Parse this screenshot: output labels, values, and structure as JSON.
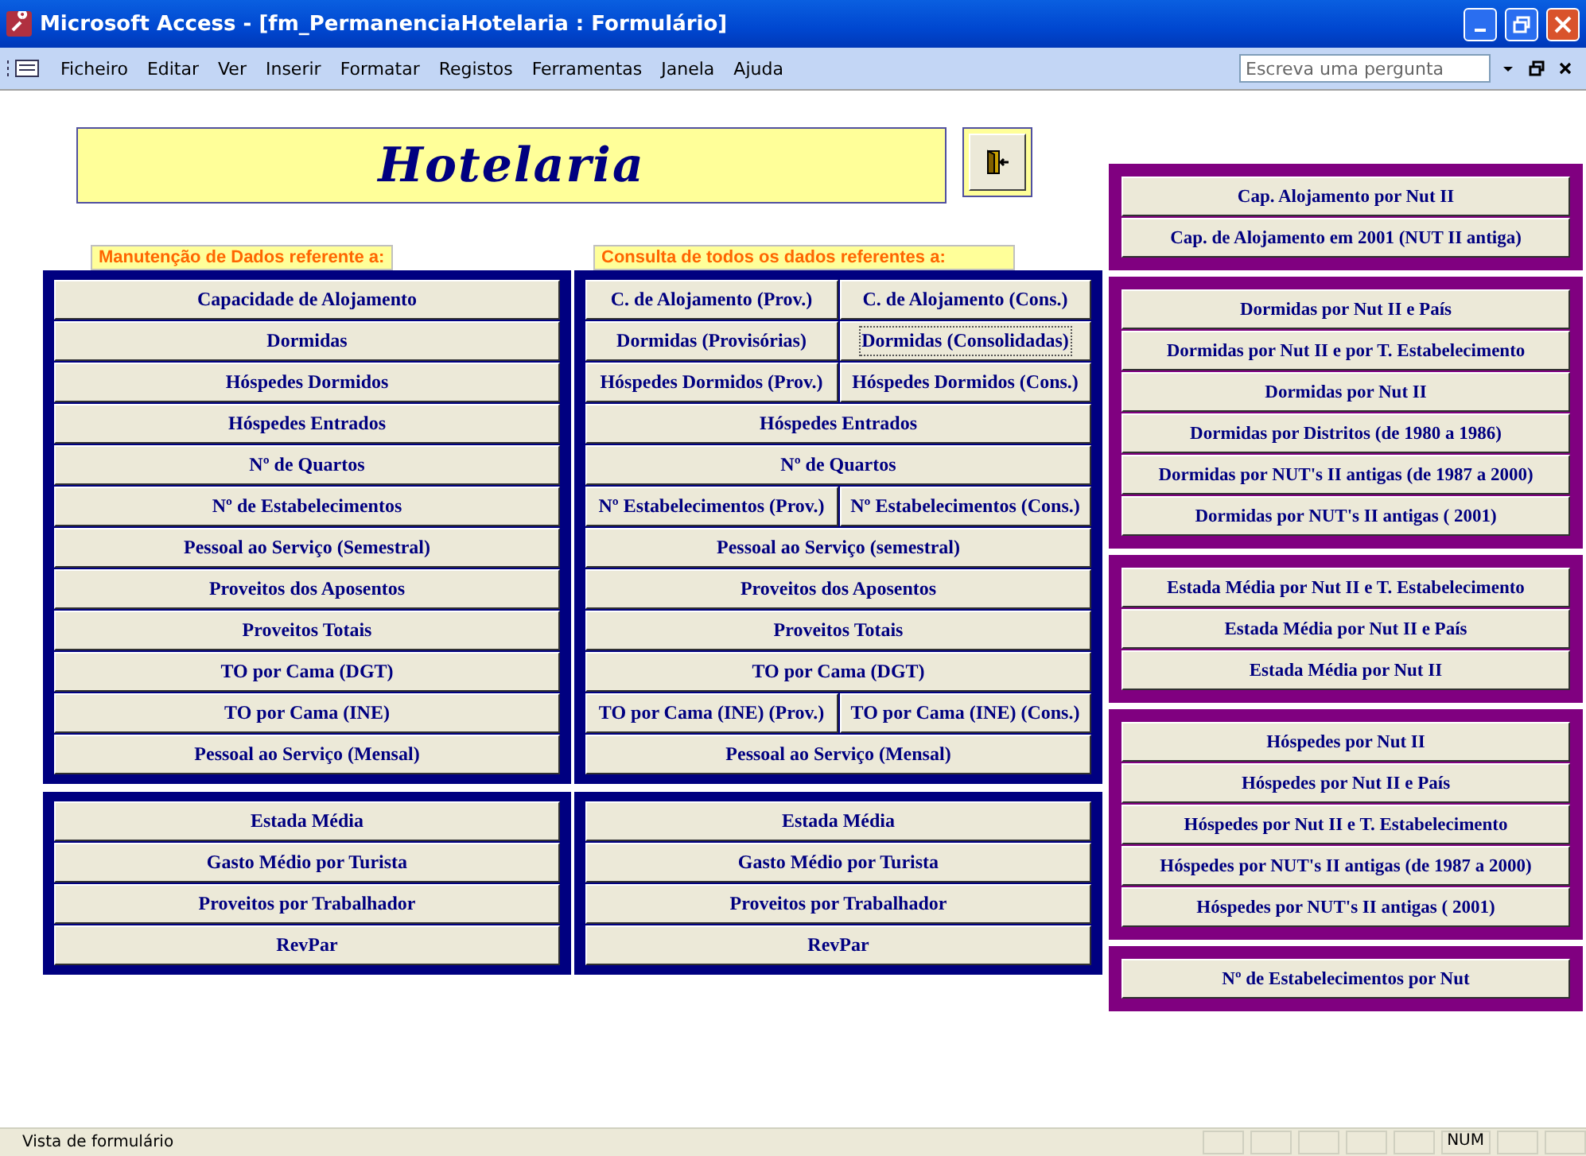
{
  "window": {
    "title": "Microsoft Access - [fm_PermanenciaHotelaria : Formulário]"
  },
  "menu": [
    "Ficheiro",
    "Editar",
    "Ver",
    "Inserir",
    "Formatar",
    "Registos",
    "Ferramentas",
    "Janela",
    "Ajuda"
  ],
  "help_search": {
    "placeholder": "Escreva uma pergunta"
  },
  "form": {
    "title": "Hotelaria",
    "left": {
      "label": "Manutenção de Dados referente a:",
      "buttons": [
        "Capacidade de Alojamento",
        "Dormidas",
        "Hóspedes Dormidos",
        "Hóspedes Entrados",
        "Nº de Quartos",
        "Nº de Estabelecimentos",
        "Pessoal ao Serviço (Semestral)",
        "Proveitos dos Aposentos",
        "Proveitos Totais",
        "TO por Cama (DGT)",
        "TO por Cama (INE)",
        "Pessoal ao Serviço (Mensal)"
      ],
      "extra_buttons": [
        "Estada Média",
        "Gasto Médio por Turista",
        "Proveitos por Trabalhador",
        "RevPar"
      ]
    },
    "middle": {
      "label": "Consulta de todos os dados referentes a:",
      "rows": [
        [
          {
            "label": "C. de  Alojamento (Prov.)",
            "focused": false
          },
          {
            "label": "C. de Alojamento (Cons.)",
            "focused": false
          }
        ],
        [
          {
            "label": "Dormidas (Provisórias)",
            "focused": false
          },
          {
            "label": "Dormidas (Consolidadas)",
            "focused": true
          }
        ],
        [
          {
            "label": "Hóspedes Dormidos (Prov.)",
            "focused": false
          },
          {
            "label": "Hóspedes Dormidos (Cons.)",
            "focused": false
          }
        ],
        [
          {
            "label": "Hóspedes Entrados",
            "focused": false
          }
        ],
        [
          {
            "label": "Nº de Quartos",
            "focused": false
          }
        ],
        [
          {
            "label": "Nº Estabelecimentos (Prov.)",
            "focused": false
          },
          {
            "label": "Nº Estabelecimentos (Cons.)",
            "focused": false
          }
        ],
        [
          {
            "label": "Pessoal ao Serviço (semestral)",
            "focused": false
          }
        ],
        [
          {
            "label": "Proveitos dos Aposentos",
            "focused": false
          }
        ],
        [
          {
            "label": "Proveitos Totais",
            "focused": false
          }
        ],
        [
          {
            "label": "TO por Cama (DGT)",
            "focused": false
          }
        ],
        [
          {
            "label": "TO por Cama (INE) (Prov.)",
            "focused": false
          },
          {
            "label": "TO por Cama (INE) (Cons.)",
            "focused": false
          }
        ],
        [
          {
            "label": "Pessoal ao Serviço (Mensal)",
            "focused": false
          }
        ]
      ],
      "extra_buttons": [
        "Estada Média",
        "Gasto Médio por Turista",
        "Proveitos por Trabalhador",
        "RevPar"
      ]
    },
    "right_groups": [
      [
        "Cap. Alojamento por Nut II",
        "Cap. de Alojamento em 2001 (NUT II antiga)"
      ],
      [
        "Dormidas por Nut II e País",
        "Dormidas por Nut II e por T. Estabelecimento",
        "Dormidas por Nut II",
        "Dormidas por Distritos (de 1980 a 1986)",
        "Dormidas por NUT's II antigas (de 1987 a 2000)",
        "Dormidas por NUT's II antigas ( 2001)"
      ],
      [
        "Estada Média por Nut II e T. Estabelecimento",
        "Estada Média por Nut II e País",
        "Estada Média por Nut II"
      ],
      [
        "Hóspedes por Nut II",
        "Hóspedes por Nut II e País",
        "Hóspedes por Nut II e T. Estabelecimento",
        "Hóspedes por NUT's II antigas (de 1987 a 2000)",
        "Hóspedes  por NUT's II antigas ( 2001)"
      ],
      [
        "Nº de Estabelecimentos por Nut"
      ]
    ]
  },
  "status_bar": {
    "text": "Vista de formulário",
    "indicator": "NUM"
  }
}
